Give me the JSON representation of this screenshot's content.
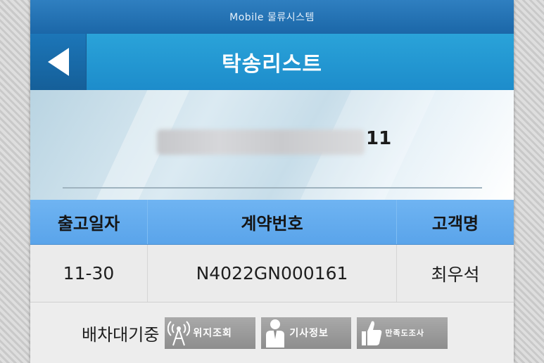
{
  "status_bar": {
    "title": "Mobile 물류시스템"
  },
  "header": {
    "title": "탁송리스트",
    "back_icon": "back-arrow-icon"
  },
  "banner": {
    "number_suffix": "11"
  },
  "table": {
    "columns": [
      "출고일자",
      "계약번호",
      "고객명"
    ],
    "rows": [
      {
        "date": "11-30",
        "contract": "N4022GN000161",
        "customer": "최우석"
      }
    ]
  },
  "dispatch": {
    "label": "배차대기중",
    "buttons": [
      {
        "label": "위지조회",
        "icon": "signal-tower-icon"
      },
      {
        "label": "기사정보",
        "icon": "driver-person-icon"
      },
      {
        "label": "만족도조사",
        "icon": "thumbs-up-icon"
      }
    ]
  },
  "colors": {
    "status_bar": "#1b67a8",
    "title_bar": "#1d8ccb",
    "table_header": "#5aa4ea",
    "button_gray": "#999999"
  }
}
